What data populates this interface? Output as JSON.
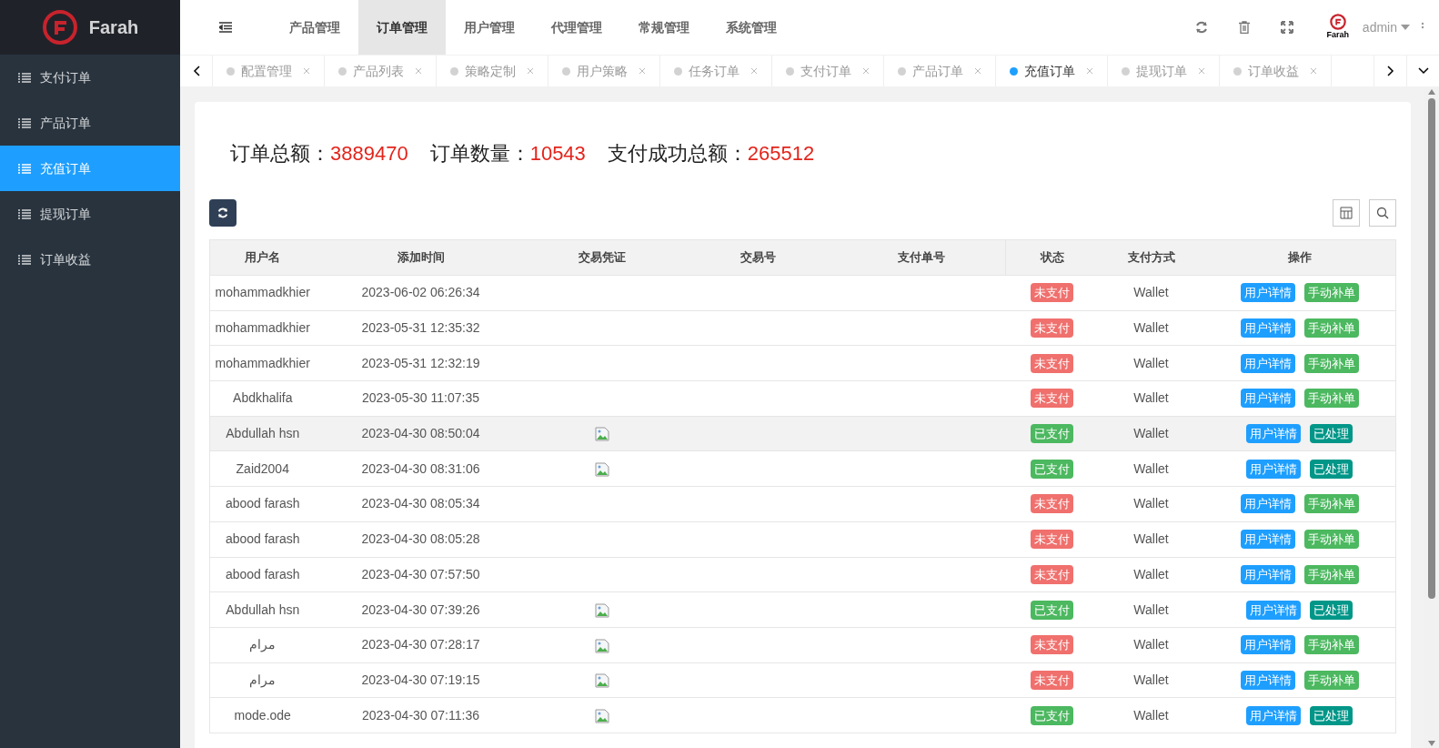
{
  "logo": {
    "text": "Farah"
  },
  "sidebar": {
    "items": [
      {
        "label": "支付订单",
        "selected": false
      },
      {
        "label": "产品订单",
        "selected": false
      },
      {
        "label": "充值订单",
        "selected": true
      },
      {
        "label": "提现订单",
        "selected": false
      },
      {
        "label": "订单收益",
        "selected": false
      }
    ]
  },
  "top_nav": {
    "items": [
      {
        "label": "产品管理",
        "selected": false
      },
      {
        "label": "订单管理",
        "selected": true
      },
      {
        "label": "用户管理",
        "selected": false
      },
      {
        "label": "代理管理",
        "selected": false
      },
      {
        "label": "常规管理",
        "selected": false
      },
      {
        "label": "系统管理",
        "selected": false
      }
    ],
    "user": "admin",
    "avatar_text": "Farah"
  },
  "page_tabs": [
    {
      "label": "配置管理",
      "selected": false
    },
    {
      "label": "产品列表",
      "selected": false
    },
    {
      "label": "策略定制",
      "selected": false
    },
    {
      "label": "用户策略",
      "selected": false
    },
    {
      "label": "任务订单",
      "selected": false
    },
    {
      "label": "支付订单",
      "selected": false
    },
    {
      "label": "产品订单",
      "selected": false
    },
    {
      "label": "充值订单",
      "selected": true
    },
    {
      "label": "提现订单",
      "selected": false
    },
    {
      "label": "订单收益",
      "selected": false
    }
  ],
  "summary": [
    {
      "label": "订单总额：",
      "value": "3889470"
    },
    {
      "label": "订单数量：",
      "value": "10543"
    },
    {
      "label": "支付成功总额：",
      "value": "265512"
    }
  ],
  "table": {
    "columns": [
      "用户名",
      "添加时间",
      "交易凭证",
      "交易号",
      "支付单号",
      "状态",
      "支付方式",
      "操作"
    ],
    "rows": [
      {
        "user": "mohammadkhier",
        "time": "2023-06-02 06:26:34",
        "voucher": false,
        "status": {
          "kind": "unpaid",
          "label": "未支付"
        },
        "method": "Wallet",
        "actions": [
          "用户详情",
          "手动补单"
        ],
        "highlighted": false
      },
      {
        "user": "mohammadkhier",
        "time": "2023-05-31 12:35:32",
        "voucher": false,
        "status": {
          "kind": "unpaid",
          "label": "未支付"
        },
        "method": "Wallet",
        "actions": [
          "用户详情",
          "手动补单"
        ],
        "highlighted": false
      },
      {
        "user": "mohammadkhier",
        "time": "2023-05-31 12:32:19",
        "voucher": false,
        "status": {
          "kind": "unpaid",
          "label": "未支付"
        },
        "method": "Wallet",
        "actions": [
          "用户详情",
          "手动补单"
        ],
        "highlighted": false
      },
      {
        "user": "Abdkhalifa",
        "time": "2023-05-30 11:07:35",
        "voucher": false,
        "status": {
          "kind": "unpaid",
          "label": "未支付"
        },
        "method": "Wallet",
        "actions": [
          "用户详情",
          "手动补单"
        ],
        "highlighted": false
      },
      {
        "user": "Abdullah hsn",
        "time": "2023-04-30 08:50:04",
        "voucher": true,
        "status": {
          "kind": "paid",
          "label": "已支付"
        },
        "method": "Wallet",
        "actions": [
          "用户详情",
          "已处理"
        ],
        "highlighted": true
      },
      {
        "user": "Zaid2004",
        "time": "2023-04-30 08:31:06",
        "voucher": true,
        "status": {
          "kind": "paid",
          "label": "已支付"
        },
        "method": "Wallet",
        "actions": [
          "用户详情",
          "已处理"
        ],
        "highlighted": false
      },
      {
        "user": "abood farash",
        "time": "2023-04-30 08:05:34",
        "voucher": false,
        "status": {
          "kind": "unpaid",
          "label": "未支付"
        },
        "method": "Wallet",
        "actions": [
          "用户详情",
          "手动补单"
        ],
        "highlighted": false
      },
      {
        "user": "abood farash",
        "time": "2023-04-30 08:05:28",
        "voucher": false,
        "status": {
          "kind": "unpaid",
          "label": "未支付"
        },
        "method": "Wallet",
        "actions": [
          "用户详情",
          "手动补单"
        ],
        "highlighted": false
      },
      {
        "user": "abood farash",
        "time": "2023-04-30 07:57:50",
        "voucher": false,
        "status": {
          "kind": "unpaid",
          "label": "未支付"
        },
        "method": "Wallet",
        "actions": [
          "用户详情",
          "手动补单"
        ],
        "highlighted": false
      },
      {
        "user": "Abdullah hsn",
        "time": "2023-04-30 07:39:26",
        "voucher": true,
        "status": {
          "kind": "paid",
          "label": "已支付"
        },
        "method": "Wallet",
        "actions": [
          "用户详情",
          "已处理"
        ],
        "highlighted": false
      },
      {
        "user": "مرام",
        "time": "2023-04-30 07:28:17",
        "voucher": true,
        "status": {
          "kind": "unpaid",
          "label": "未支付"
        },
        "method": "Wallet",
        "actions": [
          "用户详情",
          "手动补单"
        ],
        "highlighted": false
      },
      {
        "user": "مرام",
        "time": "2023-04-30 07:19:15",
        "voucher": true,
        "status": {
          "kind": "unpaid",
          "label": "未支付"
        },
        "method": "Wallet",
        "actions": [
          "用户详情",
          "手动补单"
        ],
        "highlighted": false
      },
      {
        "user": "mode.ode",
        "time": "2023-04-30 07:11:36",
        "voucher": true,
        "status": {
          "kind": "paid",
          "label": "已支付"
        },
        "method": "Wallet",
        "actions": [
          "用户详情",
          "已处理"
        ],
        "highlighted": false
      }
    ]
  }
}
